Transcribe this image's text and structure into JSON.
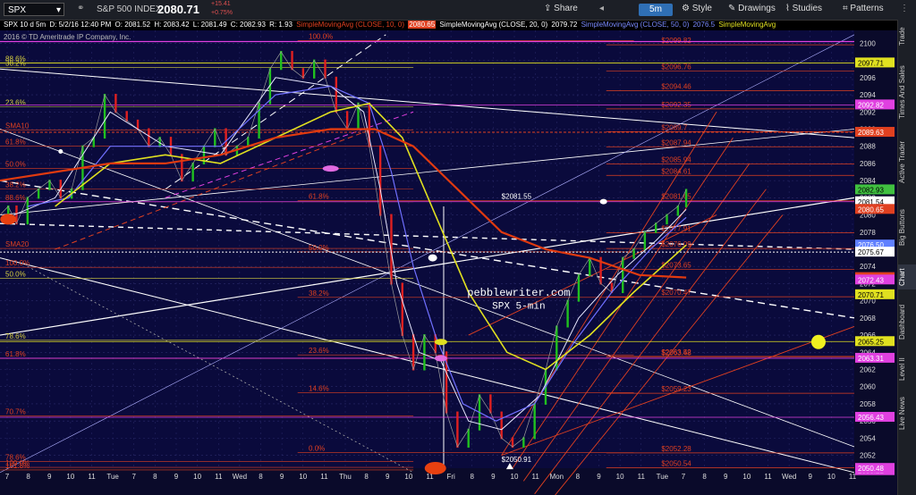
{
  "toolbar": {
    "symbol": "SPX",
    "name": "S&P 500 INDEX",
    "last": "2080.71",
    "change": "+15.41",
    "change_pct": "+0.75%",
    "interval": "5m",
    "share": "Share",
    "style": "Style",
    "drawings": "Drawings",
    "studies": "Studies",
    "patterns": "Patterns"
  },
  "infobar": {
    "title": "SPX 10 d 5m",
    "date": "D: 5/2/16 12:40 PM",
    "open": "O: 2081.52",
    "high": "H: 2083.42",
    "low": "L: 2081.49",
    "close": "C: 2082.93",
    "range": "R: 1.93",
    "sma10": "SimpleMovingAvg (CLOSE, 10, 0)",
    "sma10_val": "2080.65",
    "sma20": "SimpleMovingAvg (CLOSE, 20, 0)",
    "sma20_val": "2079.72",
    "sma50": "SimpleMovingAvg (CLOSE, 50, 0)",
    "sma50_val": "2076.5",
    "sma100": "SimpleMovingAvg"
  },
  "copyright": "2016 © TD Ameritrade IP Company, Inc.",
  "sidebar": [
    "Trade",
    "Times And Sales",
    "Active Trader",
    "Big Buttons",
    "Chart",
    "Dashboard",
    "Level II",
    "Live News"
  ],
  "colors": {
    "background": "#0a0a3c",
    "grid": "#2a2a6a",
    "sma10": "#e8e8ff",
    "sma20": "#7070ff",
    "sma50": "#e0e020",
    "sma100": "#e03a10",
    "fib": "#e04020",
    "fib_alt": "#d8d040",
    "accent_pink": "#e040e0"
  },
  "chart_data": {
    "type": "line",
    "title": "SPX 10 d 5m",
    "ylim": [
      2050.5,
      2101.5
    ],
    "y_ticks": [
      2052,
      2054,
      2056,
      2058,
      2060,
      2062,
      2064,
      2066,
      2068,
      2070,
      2072,
      2074,
      2076,
      2078,
      2080,
      2082,
      2084,
      2086,
      2088,
      2090,
      2092,
      2094,
      2096,
      2098,
      2100
    ],
    "x_ticks": [
      "7",
      "8",
      "9",
      "10",
      "11",
      "Tue",
      "7",
      "8",
      "9",
      "10",
      "11",
      "Wed",
      "8",
      "9",
      "10",
      "11",
      "Thu",
      "8",
      "9",
      "10",
      "11",
      "Fri",
      "8",
      "9",
      "10",
      "11",
      "Mon",
      "8",
      "9",
      "10",
      "11",
      "Tue",
      "7",
      "8",
      "9",
      "10",
      "11",
      "Wed",
      "9",
      "10",
      "11"
    ],
    "price_path": [
      [
        0,
        2080
      ],
      [
        3,
        2081
      ],
      [
        6,
        2079
      ],
      [
        10,
        2082
      ],
      [
        14,
        2083
      ],
      [
        18,
        2084
      ],
      [
        22,
        2082
      ],
      [
        26,
        2083
      ],
      [
        30,
        2088
      ],
      [
        34,
        2089
      ],
      [
        38,
        2094
      ],
      [
        42,
        2092
      ],
      [
        46,
        2091
      ],
      [
        50,
        2090
      ],
      [
        54,
        2088
      ],
      [
        58,
        2089
      ],
      [
        62,
        2087
      ],
      [
        66,
        2084
      ],
      [
        70,
        2086
      ],
      [
        74,
        2088
      ],
      [
        78,
        2090
      ],
      [
        82,
        2087
      ],
      [
        86,
        2088
      ],
      [
        90,
        2089
      ],
      [
        94,
        2093
      ],
      [
        98,
        2097
      ],
      [
        102,
        2099
      ],
      [
        106,
        2097
      ],
      [
        110,
        2096
      ],
      [
        114,
        2098
      ],
      [
        118,
        2096
      ],
      [
        122,
        2092
      ],
      [
        126,
        2090
      ],
      [
        130,
        2093
      ],
      [
        134,
        2088
      ],
      [
        138,
        2080
      ],
      [
        142,
        2072
      ],
      [
        146,
        2066
      ],
      [
        150,
        2062
      ],
      [
        154,
        2066
      ],
      [
        158,
        2064
      ],
      [
        162,
        2057
      ],
      [
        166,
        2053
      ],
      [
        170,
        2055
      ],
      [
        174,
        2059
      ],
      [
        178,
        2057
      ],
      [
        182,
        2054
      ],
      [
        186,
        2053
      ],
      [
        190,
        2054
      ],
      [
        194,
        2058
      ],
      [
        198,
        2062
      ],
      [
        202,
        2067
      ],
      [
        206,
        2070
      ],
      [
        210,
        2073
      ],
      [
        214,
        2075
      ],
      [
        218,
        2072
      ],
      [
        222,
        2071
      ],
      [
        226,
        2075
      ],
      [
        230,
        2076
      ],
      [
        234,
        2078
      ],
      [
        238,
        2079
      ],
      [
        242,
        2080
      ],
      [
        246,
        2081
      ],
      [
        249,
        2082.93
      ]
    ],
    "series": [
      {
        "name": "SimpleMovingAvg (CLOSE, 10, 0)",
        "last": 2080.65,
        "values": [
          [
            5,
            2080
          ],
          [
            20,
            2082
          ],
          [
            40,
            2092
          ],
          [
            60,
            2088
          ],
          [
            80,
            2087
          ],
          [
            100,
            2096
          ],
          [
            120,
            2095
          ],
          [
            132,
            2092
          ],
          [
            138,
            2083
          ],
          [
            144,
            2072
          ],
          [
            152,
            2064
          ],
          [
            160,
            2063
          ],
          [
            170,
            2056
          ],
          [
            182,
            2055
          ],
          [
            196,
            2059
          ],
          [
            210,
            2068
          ],
          [
            224,
            2073
          ],
          [
            238,
            2077
          ],
          [
            249,
            2080.65
          ]
        ]
      },
      {
        "name": "SimpleMovingAvg (CLOSE, 20, 0)",
        "last": 2079.72,
        "values": [
          [
            10,
            2081
          ],
          [
            25,
            2082
          ],
          [
            40,
            2088
          ],
          [
            60,
            2088
          ],
          [
            80,
            2088
          ],
          [
            100,
            2094
          ],
          [
            120,
            2095
          ],
          [
            134,
            2093
          ],
          [
            142,
            2085
          ],
          [
            150,
            2074
          ],
          [
            158,
            2066
          ],
          [
            168,
            2058
          ],
          [
            180,
            2056
          ],
          [
            194,
            2058
          ],
          [
            208,
            2065
          ],
          [
            222,
            2071
          ],
          [
            236,
            2076
          ],
          [
            249,
            2079.72
          ]
        ]
      },
      {
        "name": "SimpleMovingAvg (CLOSE, 50, 0)",
        "last": 2076.5,
        "values": [
          [
            20,
            2081
          ],
          [
            40,
            2086
          ],
          [
            60,
            2087
          ],
          [
            80,
            2086
          ],
          [
            100,
            2089
          ],
          [
            120,
            2092
          ],
          [
            134,
            2093
          ],
          [
            146,
            2089
          ],
          [
            158,
            2080
          ],
          [
            170,
            2071
          ],
          [
            184,
            2064
          ],
          [
            198,
            2062
          ],
          [
            214,
            2066
          ],
          [
            230,
            2071
          ],
          [
            249,
            2076.5
          ]
        ]
      },
      {
        "name": "SimpleMovingAvg",
        "last": 2072.71,
        "values": [
          [
            0,
            2084
          ],
          [
            20,
            2085
          ],
          [
            40,
            2086
          ],
          [
            60,
            2086
          ],
          [
            80,
            2087
          ],
          [
            100,
            2089
          ],
          [
            120,
            2090
          ],
          [
            136,
            2090
          ],
          [
            150,
            2088
          ],
          [
            166,
            2083
          ],
          [
            182,
            2078
          ],
          [
            198,
            2076
          ],
          [
            214,
            2075
          ],
          [
            232,
            2073
          ],
          [
            249,
            2072.71
          ]
        ]
      }
    ],
    "right_axis_labels": [
      {
        "value": 2097.71,
        "color": "#e0e020"
      },
      {
        "value": 2092.82,
        "color": "#e040e0"
      },
      {
        "value": 2089.63,
        "color": "#e04020"
      },
      {
        "value": 2082.93,
        "color": "#40c040"
      },
      {
        "value": 2081.54,
        "color": "#ffffff"
      },
      {
        "value": 2080.65,
        "color": "#e04020"
      },
      {
        "value": 2076.5,
        "color": "#6080ff"
      },
      {
        "value": 2075.67,
        "color": "#ffffff"
      },
      {
        "value": 2072.71,
        "color": "#e04020"
      },
      {
        "value": 2072.43,
        "color": "#e040e0"
      },
      {
        "value": 2070.71,
        "color": "#e0e020"
      },
      {
        "value": 2065.25,
        "color": "#e0e020"
      },
      {
        "value": 2063.31,
        "color": "#e040e0"
      },
      {
        "value": 2056.43,
        "color": "#e040e0"
      },
      {
        "value": 2050.22,
        "color": "#e040e0"
      },
      {
        "value": 2050.48,
        "color": "#e040e0"
      }
    ],
    "fib_levels_right": [
      {
        "label": "$2096.76",
        "value": 2096.76
      },
      {
        "label": "$2094.46",
        "value": 2094.46
      },
      {
        "label": "$2092.35",
        "value": 2092.35
      },
      {
        "label": "$2089.7",
        "value": 2089.7
      },
      {
        "label": "$2087.94",
        "value": 2087.94
      },
      {
        "label": "$2085.94",
        "value": 2085.94
      },
      {
        "label": "$2084.61",
        "value": 2084.61
      },
      {
        "label": "$2081.65",
        "value": 2081.65
      },
      {
        "label": "$2077.91",
        "value": 2077.91
      },
      {
        "label": "$2076.09",
        "value": 2076.09
      },
      {
        "label": "$2073.65",
        "value": 2073.65
      },
      {
        "label": "$2070.47",
        "value": 2070.47
      },
      {
        "label": "$2063.52",
        "value": 2063.52
      },
      {
        "label": "$2063.48",
        "value": 2063.48
      },
      {
        "label": "$2059.23",
        "value": 2059.23
      },
      {
        "label": "$2052.28",
        "value": 2052.28
      },
      {
        "label": "$2099.82",
        "value": 2099.82
      },
      {
        "label": "$2050.54",
        "value": 2050.54
      }
    ],
    "fib_levels_left": [
      {
        "label": "88.6%",
        "value": 2097.71
      },
      {
        "label": "38.2%",
        "value": 2097.2
      },
      {
        "label": "23.6%",
        "value": 2092.6
      },
      {
        "label": "SMA10",
        "value": 2089.9
      },
      {
        "label": "61.8%",
        "value": 2088.0
      },
      {
        "label": "50.0%",
        "value": 2085.4
      },
      {
        "label": "38.2%",
        "value": 2083.0
      },
      {
        "label": "88.6%",
        "value": 2081.54
      },
      {
        "label": "SMA20",
        "value": 2076.1
      },
      {
        "label": "100.0%",
        "value": 2073.9
      },
      {
        "label": "50.0%",
        "value": 2072.6
      },
      {
        "label": "78.6%",
        "value": 2065.4
      },
      {
        "label": "61.8%",
        "value": 2063.3
      },
      {
        "label": "70.7%",
        "value": 2056.6
      },
      {
        "label": "78.6%",
        "value": 2051.3
      },
      {
        "label": "100.0%",
        "value": 2050.6
      },
      {
        "label": "161.8%",
        "value": 2050.3
      }
    ],
    "fib_levels_mid": [
      {
        "label": "61.8%",
        "value": 2081.65
      },
      {
        "label": "50.0%",
        "value": 2075.7
      },
      {
        "label": "38.2%",
        "value": 2070.4
      },
      {
        "label": "23.6%",
        "value": 2063.7
      },
      {
        "label": "14.6%",
        "value": 2059.3
      },
      {
        "label": "0.0%",
        "value": 2052.3
      },
      {
        "label": "100.0%",
        "value": 2100.3
      }
    ],
    "annotations": {
      "top_label": "$2081.55",
      "low_label": "$2050.91",
      "watermark_1": "pebblewriter.com",
      "watermark_2": "SPX 5-min"
    }
  }
}
